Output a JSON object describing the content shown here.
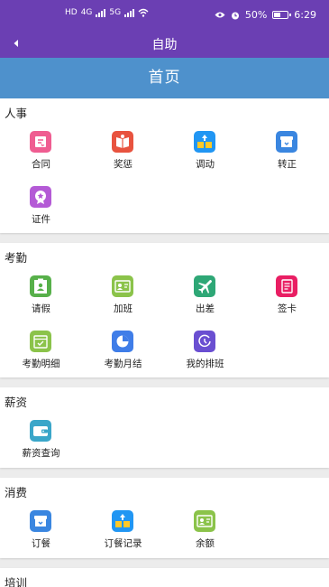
{
  "status_bar": {
    "left_labels": [
      "HD",
      "4G",
      "5G"
    ],
    "battery_percent": "50%",
    "battery_level": 0.5,
    "time": "6:29",
    "icons": [
      "wifi-icon",
      "eye-icon",
      "alarm-icon",
      "battery-icon"
    ]
  },
  "app_bar": {
    "title": "自助",
    "back_icon": "back-arrow-icon"
  },
  "home_bar": {
    "title": "首页"
  },
  "colors": {
    "app_bar": "#6b3fb3",
    "home_bar": "#4e91cc",
    "background": "#ececec"
  },
  "sections": [
    {
      "title": "人事",
      "items": [
        {
          "label": "合同",
          "icon": "contract-icon",
          "color": "#ef5d91"
        },
        {
          "label": "奖惩",
          "icon": "reward-punish-icon",
          "color": "#e8533f"
        },
        {
          "label": "调动",
          "icon": "transfer-icon",
          "color": "#2196f3"
        },
        {
          "label": "转正",
          "icon": "regularization-icon",
          "color": "#3a86e0"
        },
        {
          "label": "证件",
          "icon": "certificate-icon",
          "color": "#b45ad6"
        }
      ]
    },
    {
      "title": "考勤",
      "items": [
        {
          "label": "请假",
          "icon": "leave-icon",
          "color": "#57b04a"
        },
        {
          "label": "加班",
          "icon": "overtime-icon",
          "color": "#8bc34a"
        },
        {
          "label": "出差",
          "icon": "business-trip-icon",
          "color": "#2ea776"
        },
        {
          "label": "签卡",
          "icon": "sign-card-icon",
          "color": "#e91e63"
        },
        {
          "label": "考勤明细",
          "icon": "attendance-detail-icon",
          "color": "#8bc34a"
        },
        {
          "label": "考勤月结",
          "icon": "attendance-monthly-icon",
          "color": "#3f7de8"
        },
        {
          "label": "我的排班",
          "icon": "my-schedule-icon",
          "color": "#6a4fd1"
        }
      ]
    },
    {
      "title": "薪资",
      "items": [
        {
          "label": "薪资查询",
          "icon": "salary-query-icon",
          "color": "#3aa6c9"
        }
      ]
    },
    {
      "title": "消费",
      "items": [
        {
          "label": "订餐",
          "icon": "meal-order-icon",
          "color": "#3a86e0"
        },
        {
          "label": "订餐记录",
          "icon": "meal-record-icon",
          "color": "#2196f3"
        },
        {
          "label": "余额",
          "icon": "balance-icon",
          "color": "#8bc34a"
        }
      ]
    },
    {
      "title": "培训",
      "items": []
    }
  ]
}
